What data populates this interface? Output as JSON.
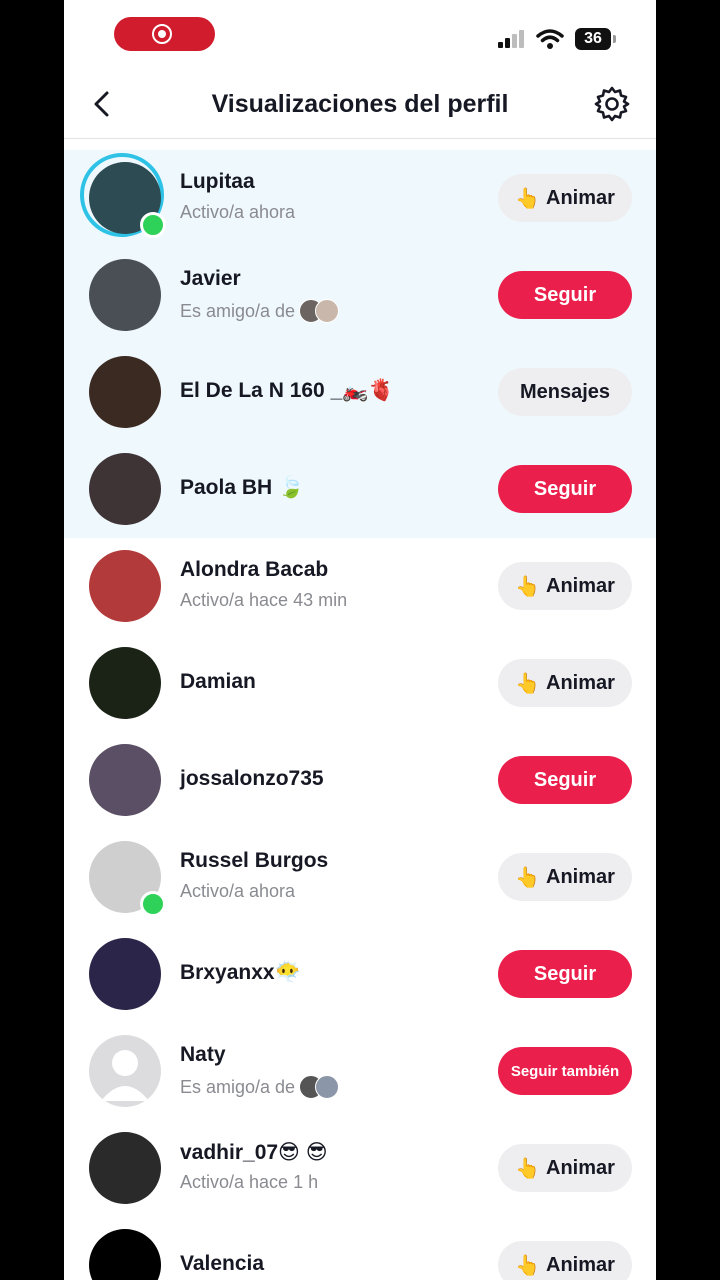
{
  "header": {
    "title": "Visualizaciones del perfil"
  },
  "status": {
    "battery": "36"
  },
  "viewers": [
    {
      "name": "Lupitaa",
      "subtitle": "Activo/a ahora",
      "action": "Animar",
      "style": "gray",
      "online": true,
      "story": true,
      "highlight": true,
      "avatar": "#2c4b52"
    },
    {
      "name": "Javier",
      "subtitle": "Es amigo/a de",
      "action": "Seguir",
      "style": "red",
      "highlight": true,
      "avatar": "#4a4f56",
      "mutuals": [
        "#6b6460",
        "#c9b7ab"
      ]
    },
    {
      "name": "El De La N 160 _🏍️🫀",
      "subtitle": "",
      "action": "Mensajes",
      "style": "gray",
      "highlight": true,
      "avatar": "#3b2a22"
    },
    {
      "name": "Paola BH 🍃",
      "subtitle": "",
      "action": "Seguir",
      "style": "red",
      "highlight": true,
      "avatar": "#3e3436"
    },
    {
      "name": "Alondra Bacab",
      "subtitle": "Activo/a hace 43 min",
      "action": "Animar",
      "style": "gray",
      "avatar": "#b33a3a"
    },
    {
      "name": "Damian",
      "subtitle": "",
      "action": "Animar",
      "style": "gray",
      "avatar": "#1b2316"
    },
    {
      "name": "jossalonzo735",
      "subtitle": "",
      "action": "Seguir",
      "style": "red",
      "avatar": "#5a4f64"
    },
    {
      "name": "Russel Burgos",
      "subtitle": "Activo/a ahora",
      "action": "Animar",
      "style": "gray",
      "online": true,
      "avatar": "#cfcfcf"
    },
    {
      "name": "Brxyanxx😶‍🌫️",
      "subtitle": "",
      "action": "Seguir",
      "style": "red",
      "avatar": "#2c254a"
    },
    {
      "name": "Naty",
      "subtitle": "Es amigo/a de",
      "action": "Seguir también",
      "style": "red",
      "small": true,
      "avatar": "#dcdcdf",
      "placeholder": true,
      "mutuals": [
        "#555",
        "#8b96a8"
      ]
    },
    {
      "name": "vadhir_07😎 😎",
      "subtitle": "Activo/a hace 1 h",
      "action": "Animar",
      "style": "gray",
      "avatar": "#2a2a2a"
    },
    {
      "name": "Valencia",
      "subtitle": "",
      "action": "Animar",
      "style": "gray",
      "avatar": "#000000"
    }
  ]
}
